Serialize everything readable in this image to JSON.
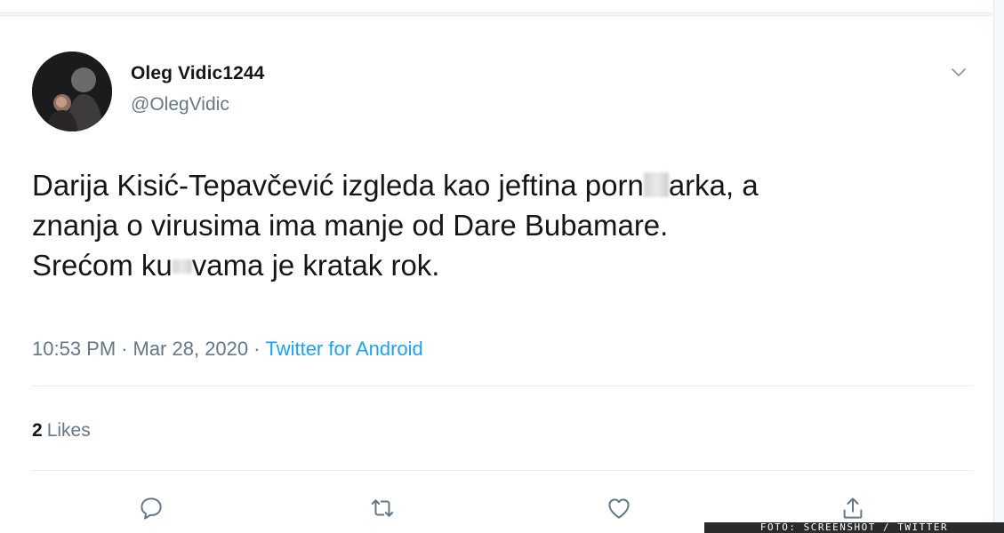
{
  "tweet": {
    "author": {
      "display_name": "Oleg Vidic1244",
      "handle": "@OlegVidic"
    },
    "text": {
      "line1_a": "Darija Kisić-Tepavčević izgleda kao jeftina porn",
      "line1_b": "arka, a",
      "line2": "znanja o virusima ima manje od Dare Bubamare.",
      "line3_a": "Srećom ku",
      "line3_b": "vama je kratak rok."
    },
    "meta": {
      "time": "10:53 PM",
      "separator": "·",
      "date": "Mar 28, 2020",
      "source": "Twitter for Android"
    },
    "likes": {
      "count": "2",
      "label": "Likes"
    }
  },
  "actions": {
    "reply_icon": "reply-icon",
    "retweet_icon": "retweet-icon",
    "like_icon": "heart-icon",
    "share_icon": "share-icon"
  },
  "watermark": {
    "text": "FOTO: SCREENSHOT / TWITTER"
  },
  "colors": {
    "primary_text": "#14171a",
    "secondary_text": "#657786",
    "link": "#1da1f2",
    "divider": "#e6ecf0"
  }
}
